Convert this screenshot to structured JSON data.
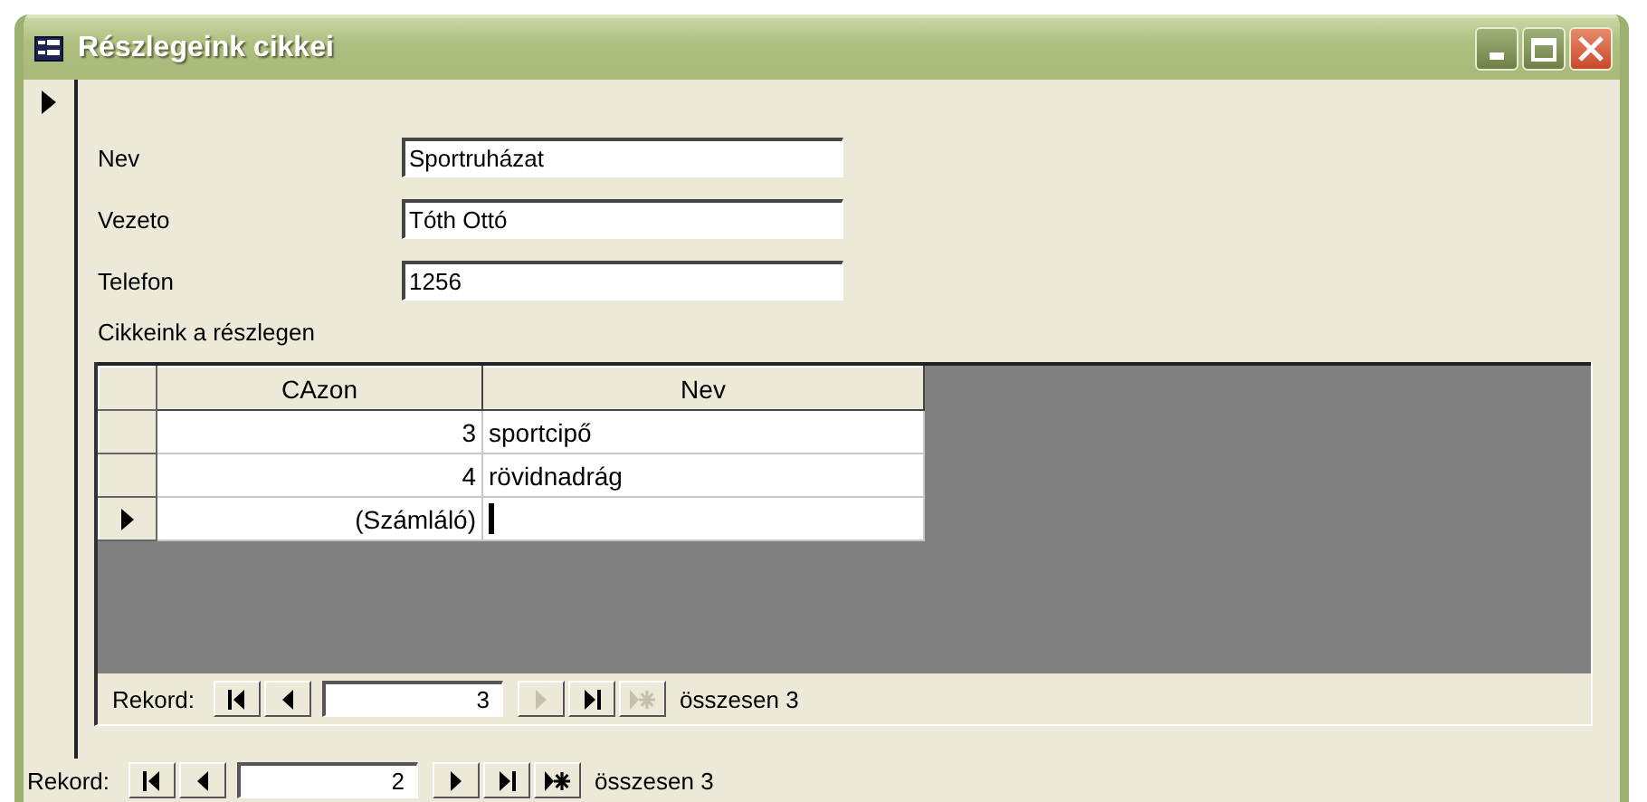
{
  "window": {
    "title": "Részlegeink cikkei"
  },
  "record": {
    "current": true
  },
  "fields": [
    {
      "label": "Nev",
      "value": "Sportruházat"
    },
    {
      "label": "Vezeto",
      "value": "Tóth Ottó"
    },
    {
      "label": "Telefon",
      "value": "1256"
    }
  ],
  "subform": {
    "label": "Cikkeink a részlegen",
    "columns": [
      "CAzon",
      "Nev"
    ],
    "rows": [
      {
        "id": "3",
        "name": "sportcipő",
        "current": false,
        "editing": false
      },
      {
        "id": "4",
        "name": "rövidnadrág",
        "current": false,
        "editing": false
      },
      {
        "id": "(Számláló)",
        "current": true,
        "editing": true
      }
    ],
    "navigator": {
      "label": "Rekord:",
      "value": "3",
      "total": "összesen 3",
      "buttons": [
        {
          "kind": "first",
          "disabled": false
        },
        {
          "kind": "prev",
          "disabled": false
        },
        {
          "kind": "next",
          "disabled": true
        },
        {
          "kind": "last",
          "disabled": false
        },
        {
          "kind": "new",
          "disabled": true
        }
      ]
    }
  },
  "navigator": {
    "label": "Rekord:",
    "value": "2",
    "total": "összesen 3",
    "buttons": [
      {
        "kind": "first",
        "disabled": false
      },
      {
        "kind": "prev",
        "disabled": false
      },
      {
        "kind": "next",
        "disabled": false
      },
      {
        "kind": "last",
        "disabled": false
      },
      {
        "kind": "new",
        "disabled": false
      }
    ]
  }
}
